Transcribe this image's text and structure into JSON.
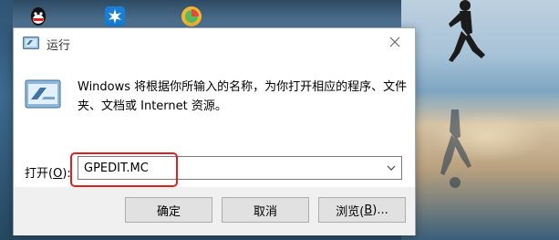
{
  "dialog": {
    "title": "运行",
    "description": "Windows 将根据你所输入的名称，为你打开相应的程序、文件夹、文档或 Internet 资源。",
    "open_label_pre": "打开(",
    "open_label_key": "O",
    "open_label_post": "):",
    "command_value": "GPEDIT.MC",
    "ok_label": "确定",
    "cancel_label": "取消",
    "browse_label_pre": "浏览(",
    "browse_label_key": "B",
    "browse_label_post": ")..."
  },
  "colors": {
    "highlight_border": "#e0201c",
    "footer_bg": "#f0f0f0",
    "button_bg": "#e1e1e1"
  },
  "icons": {
    "title": "run-icon",
    "body": "run-icon",
    "close": "close-icon",
    "dropdown": "chevron-down-icon",
    "desktop": [
      "qq-icon",
      "app-icon",
      "game-icon"
    ]
  }
}
